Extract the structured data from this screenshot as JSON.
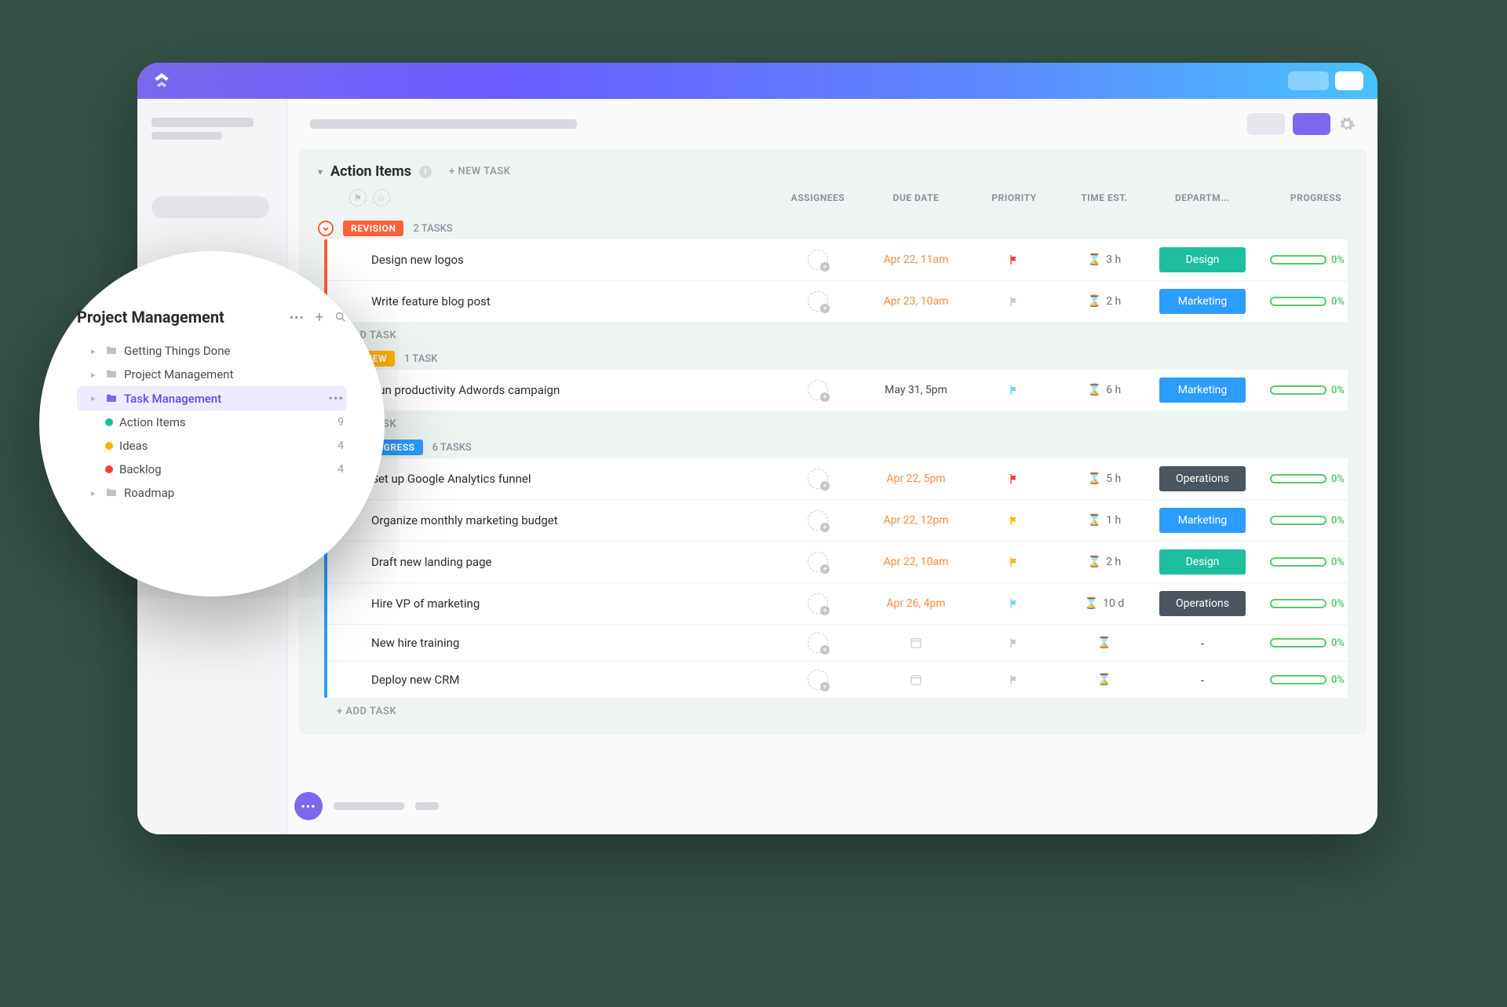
{
  "section": {
    "title": "Action Items",
    "new_task": "+ NEW TASK"
  },
  "columns": {
    "assignees": "ASSIGNEES",
    "due": "DUE DATE",
    "priority": "PRIORITY",
    "time": "TIME EST.",
    "dept": "DEPARTM...",
    "progress": "PROGRESS"
  },
  "add_task": "+ ADD TASK",
  "groups": [
    {
      "status": "REVISION",
      "color": "#ff5e3a",
      "count_label": "2 TASKS",
      "tasks": [
        {
          "name": "Design new logos",
          "due": "Apr 22, 11am",
          "due_color": "#ff8a3d",
          "flag": "#ff3b30",
          "time": "3 h",
          "dept": "Design",
          "dept_color": "#1dbf9f",
          "progress": "0%"
        },
        {
          "name": "Write feature blog post",
          "due": "Apr 23, 10am",
          "due_color": "#ff8a3d",
          "flag": "#c5c5cf",
          "time": "2 h",
          "dept": "Marketing",
          "dept_color": "#2d9cff",
          "progress": "0%"
        }
      ]
    },
    {
      "status": "REVIEW",
      "color": "#ffb400",
      "count_label": "1 TASK",
      "tasks": [
        {
          "name": "Run productivity Adwords campaign",
          "due": "May 31, 5pm",
          "due_color": "#4a4a55",
          "flag": "#7ad1ff",
          "time": "6 h",
          "dept": "Marketing",
          "dept_color": "#2d9cff",
          "progress": "0%"
        }
      ]
    },
    {
      "status": "IN PROGRESS",
      "color": "#2d9cff",
      "count_label": "6 TASKS",
      "tasks": [
        {
          "name": "Set up Google Analytics funnel",
          "due": "Apr 22, 5pm",
          "due_color": "#ff8a3d",
          "flag": "#ff3b30",
          "time": "5 h",
          "dept": "Operations",
          "dept_color": "#4a5560",
          "progress": "0%"
        },
        {
          "name": "Organize monthly marketing budget",
          "due": "Apr 22, 12pm",
          "due_color": "#ff8a3d",
          "flag": "#ffb400",
          "time": "1 h",
          "dept": "Marketing",
          "dept_color": "#2d9cff",
          "progress": "0%"
        },
        {
          "name": "Draft new landing page",
          "due": "Apr 22, 10am",
          "due_color": "#ff8a3d",
          "flag": "#ffb400",
          "time": "2 h",
          "dept": "Design",
          "dept_color": "#1dbf9f",
          "progress": "0%"
        },
        {
          "name": "Hire VP of marketing",
          "due": "Apr 26, 4pm",
          "due_color": "#ff8a3d",
          "flag": "#7ad1ff",
          "time": "10 d",
          "dept": "Operations",
          "dept_color": "#4a5560",
          "progress": "0%"
        },
        {
          "name": "New hire training",
          "due": "",
          "due_color": "",
          "flag": "#c5c5cf",
          "time": "",
          "dept": "-",
          "dept_color": "",
          "progress": "0%"
        },
        {
          "name": "Deploy new CRM",
          "due": "",
          "due_color": "",
          "flag": "#c5c5cf",
          "time": "",
          "dept": "-",
          "dept_color": "",
          "progress": "0%"
        }
      ]
    }
  ],
  "zoom": {
    "title": "Project Management",
    "tree": [
      {
        "label": "Getting Things Done",
        "type": "folder",
        "indent": 1
      },
      {
        "label": "Project Management",
        "type": "folder",
        "indent": 1
      },
      {
        "label": "Task Management",
        "type": "folder",
        "indent": 1,
        "active": true
      },
      {
        "label": "Action Items",
        "type": "leaf",
        "indent": 2,
        "dot": "#1dbf9f",
        "count": "9"
      },
      {
        "label": "Ideas",
        "type": "leaf",
        "indent": 2,
        "dot": "#ffb400",
        "count": "4"
      },
      {
        "label": "Backlog",
        "type": "leaf",
        "indent": 2,
        "dot": "#ff3b30",
        "count": "4"
      },
      {
        "label": "Roadmap",
        "type": "folder",
        "indent": 1
      }
    ]
  }
}
